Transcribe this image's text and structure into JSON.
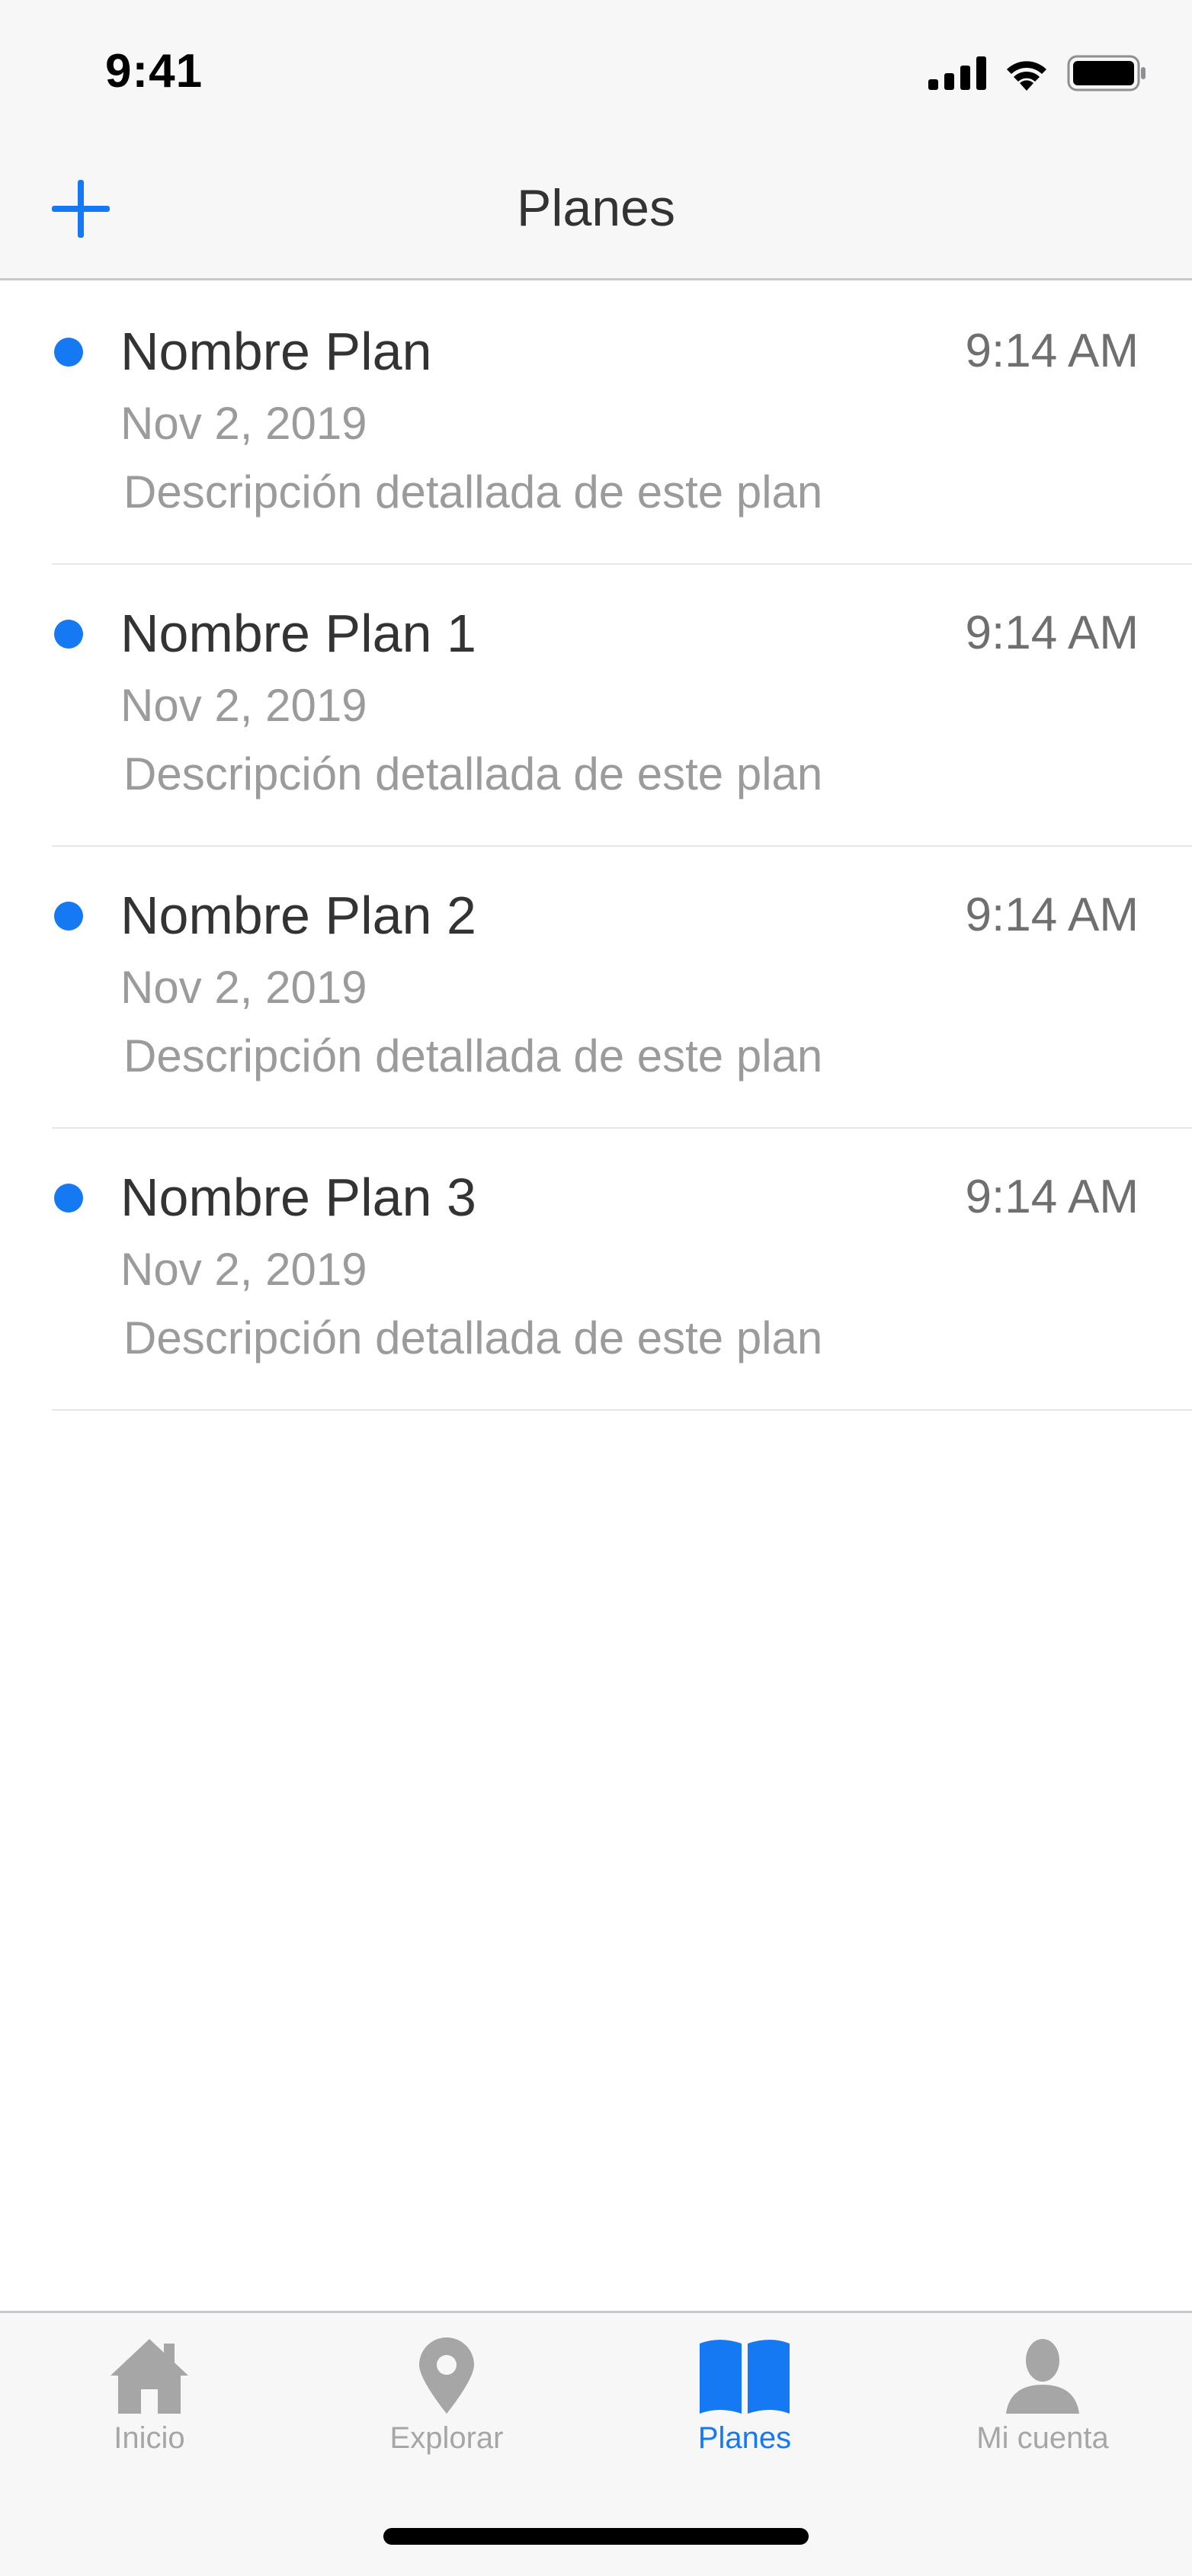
{
  "status_bar": {
    "time": "9:41",
    "icons": [
      "signal-icon",
      "wifi-icon",
      "battery-icon"
    ]
  },
  "nav": {
    "title": "Planes",
    "add_icon": "plus-icon"
  },
  "plans": [
    {
      "name": "Nombre Plan",
      "time": "9:14 AM",
      "date": "Nov 2, 2019",
      "description": "Descripción detallada de este plan"
    },
    {
      "name": "Nombre Plan 1",
      "time": "9:14 AM",
      "date": "Nov 2, 2019",
      "description": "Descripción detallada de este plan"
    },
    {
      "name": "Nombre Plan 2",
      "time": "9:14 AM",
      "date": "Nov 2, 2019",
      "description": "Descripción detallada de este plan"
    },
    {
      "name": "Nombre Plan 3",
      "time": "9:14 AM",
      "date": "Nov 2, 2019",
      "description": "Descripción detallada de este plan"
    }
  ],
  "tabs": [
    {
      "label": "Inicio",
      "icon": "home-icon",
      "active": false
    },
    {
      "label": "Explorar",
      "icon": "map-pin-icon",
      "active": false
    },
    {
      "label": "Planes",
      "icon": "book-icon",
      "active": true
    },
    {
      "label": "Mi cuenta",
      "icon": "user-icon",
      "active": false
    }
  ],
  "colors": {
    "accent": "#1479f2",
    "inactive": "#a6a6a6",
    "title_text": "#333333",
    "secondary_text": "#9b9b9b",
    "bar_background": "#f7f7f7"
  }
}
